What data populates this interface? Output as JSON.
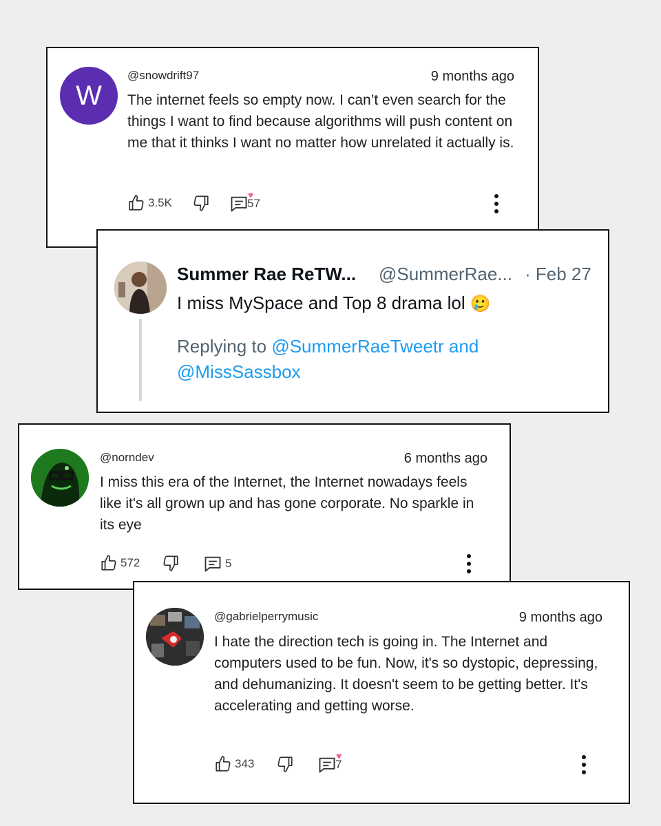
{
  "comments": [
    {
      "handle": "@snowdrift97",
      "time": "9 months ago",
      "avatar_letter": "W",
      "avatar_color": "#5b2db0",
      "text": "The internet feels so empty now. I can’t even search for the things I want to find because algorithms will push content on me that it thinks I want no matter how unrelated it actually is.",
      "likes": "3.5K",
      "replies": "57",
      "creator_heart": true
    },
    {
      "handle": "@norndev",
      "time": "6 months ago",
      "avatar_color": "#1e8a1e",
      "text": "I miss this era of the Internet, the Internet nowadays feels like it's all grown up and has gone corporate. No sparkle in its eye",
      "likes": "572",
      "replies": "5",
      "creator_heart": false
    },
    {
      "handle": "@gabrielperrymusic",
      "time": "9 months ago",
      "avatar_color": "#3b3b3b",
      "text": "I hate the direction tech is going in.  The Internet and computers used to be fun.  Now, it's so dystopic, depressing, and dehumanizing.  It doesn't seem to be getting better.  It's accelerating and getting worse.",
      "likes": "343",
      "replies": "7",
      "creator_heart": true
    }
  ],
  "tweet": {
    "name": "Summer Rae ReTW...",
    "handle": "@SummerRae...",
    "date": "· Feb 27",
    "text": "I miss MySpace and Top 8 drama lol",
    "emoji": "🥲",
    "reply_prefix": "Replying to",
    "reply_to_1": "@SummerRaeTweetr",
    "reply_and": "and",
    "reply_to_2": "@MissSassbox"
  },
  "colors": {
    "page_bg": "#eeeeee",
    "card_border": "#111111",
    "twitter_link": "#1d9bf0",
    "twitter_gray": "#536471",
    "heart": "#f06292"
  },
  "icons": [
    "thumbs-up-icon",
    "thumbs-down-icon",
    "reply-icon",
    "heart-icon",
    "more-vert-icon",
    "emoji-icon"
  ]
}
